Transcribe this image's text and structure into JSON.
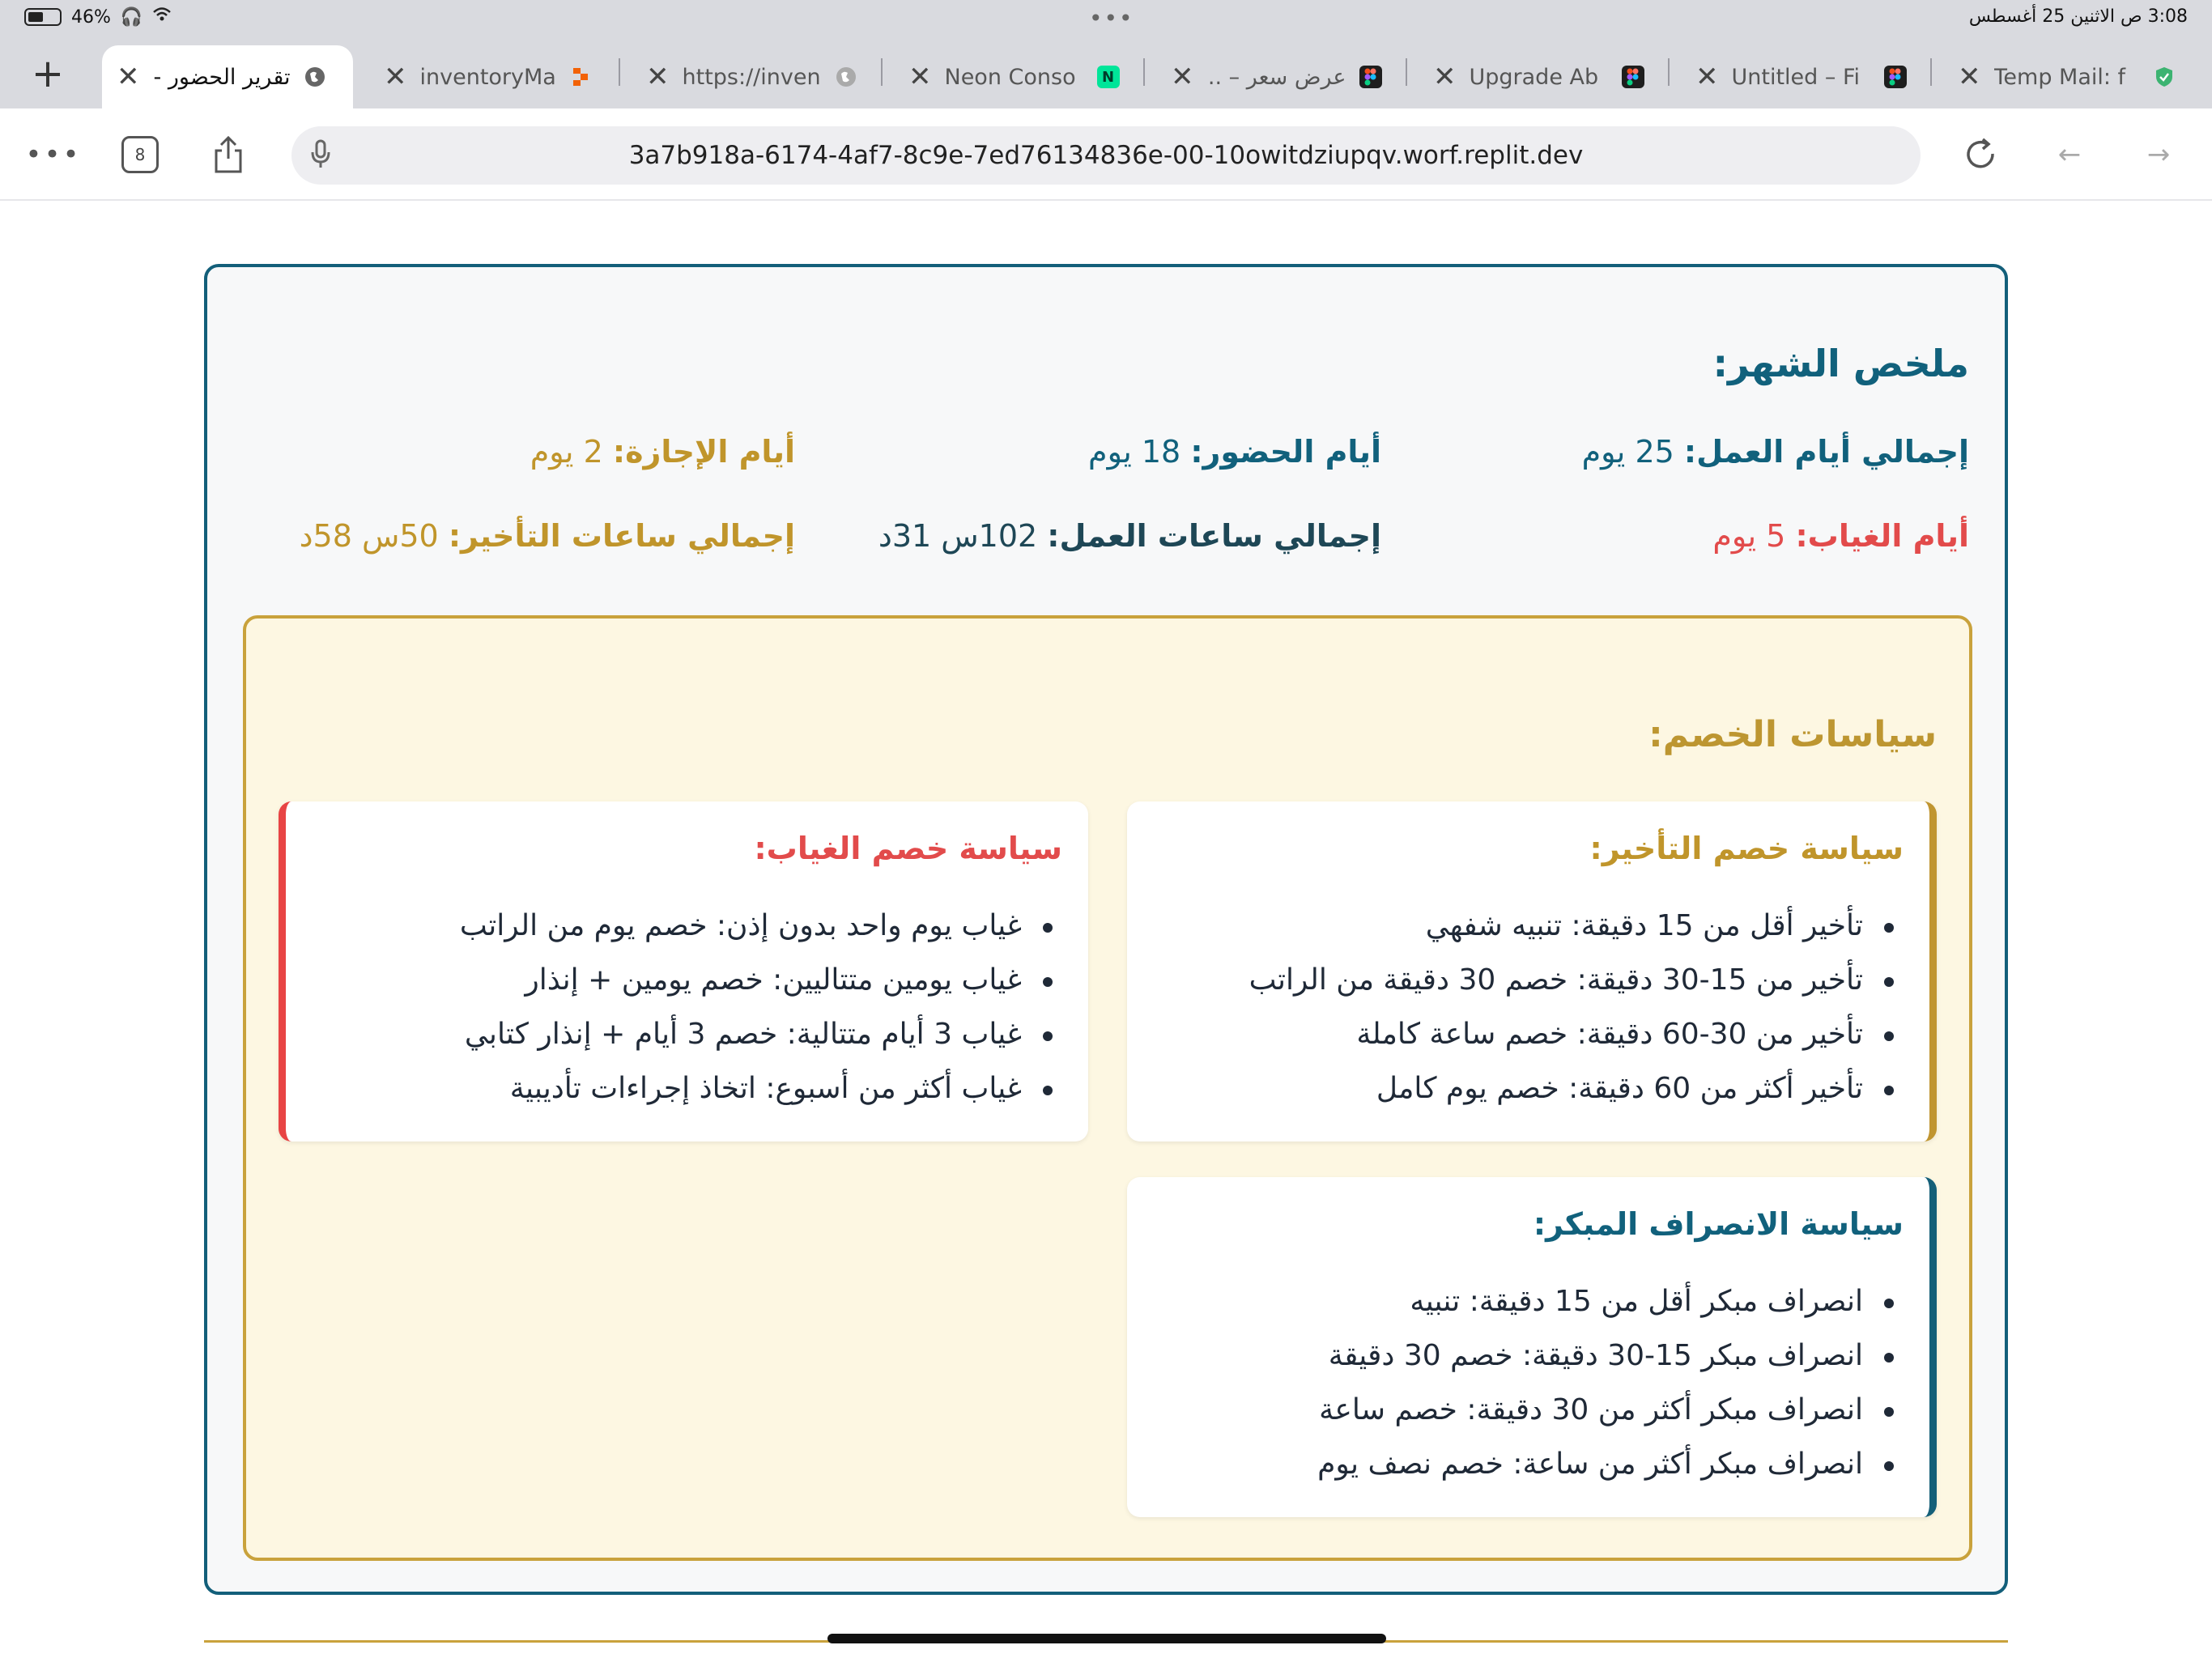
{
  "status": {
    "battery": "46%",
    "datetime": "3:08 ص   الاثنين 25 أغسطس",
    "dots": "•••"
  },
  "tabs": [
    {
      "label": "تقرير الحضور -",
      "icon": "globe-icon",
      "active": true
    },
    {
      "label": "inventoryMa",
      "icon": "replit-icon"
    },
    {
      "label": "https://inven",
      "icon": "globe-icon"
    },
    {
      "label": "Neon Conso",
      "icon": "neon-icon"
    },
    {
      "label": "عرض سعر – ..",
      "icon": "figma-icon"
    },
    {
      "label": "Upgrade Ab",
      "icon": "figma-icon"
    },
    {
      "label": "Untitled – Fi",
      "icon": "figma-icon"
    },
    {
      "label": "Temp Mail: f",
      "icon": "shield-icon"
    }
  ],
  "toolbar": {
    "more": "•••",
    "tab_count": "8",
    "url": "3a7b918a-6174-4af7-8c9e-7ed76134836e-00-10owitdziupqv.worf.replit.dev"
  },
  "summary": {
    "title": "ملخص الشهر:",
    "total_days_label": "إجمالي أيام العمل:",
    "total_days_value": "25 يوم",
    "attendance_label": "أيام الحضور:",
    "attendance_value": "18 يوم",
    "leave_label": "أيام الإجازة:",
    "leave_value": "2 يوم",
    "absence_label": "أيام الغياب:",
    "absence_value": "5 يوم",
    "work_hours_label": "إجمالي ساعات العمل:",
    "work_hours_value": "102س 31د",
    "late_hours_label": "إجمالي ساعات التأخير:",
    "late_hours_value": "50س 58د"
  },
  "policies": {
    "title": "سياسات الخصم:",
    "late": {
      "title": "سياسة خصم التأخير:",
      "items": [
        "تأخير أقل من 15 دقيقة: تنبيه شفهي",
        "تأخير من 15-30 دقيقة: خصم 30 دقيقة من الراتب",
        "تأخير من 30-60 دقيقة: خصم ساعة كاملة",
        "تأخير أكثر من 60 دقيقة: خصم يوم كامل"
      ]
    },
    "absence": {
      "title": "سياسة خصم الغياب:",
      "items": [
        "غياب يوم واحد بدون إذن: خصم يوم من الراتب",
        "غياب يومين متتاليين: خصم يومين + إنذار",
        "غياب 3 أيام متتالية: خصم 3 أيام + إنذار كتابي",
        "غياب أكثر من أسبوع: اتخاذ إجراءات تأديبية"
      ]
    },
    "early": {
      "title": "سياسة الانصراف المبكر:",
      "items": [
        "انصراف مبكر أقل من 15 دقيقة: تنبيه",
        "انصراف مبكر 15-30 دقيقة: خصم 30 دقيقة",
        "انصراف مبكر أكثر من 30 دقيقة: خصم ساعة",
        "انصراف مبكر أكثر من ساعة: خصم نصف يوم"
      ]
    }
  },
  "colors": {
    "primary": "#11617c",
    "gold": "#c0952b",
    "danger": "#e24b4b",
    "policy_bg": "#fdf7e2"
  }
}
